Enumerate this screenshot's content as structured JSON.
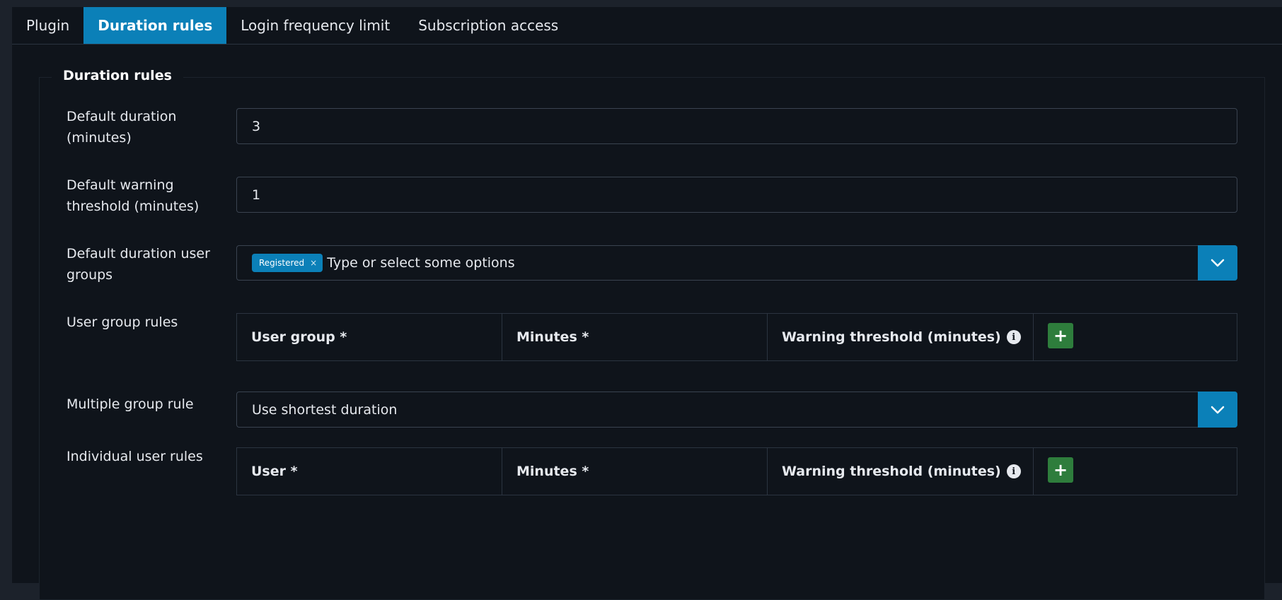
{
  "tabs": [
    {
      "label": "Plugin"
    },
    {
      "label": "Duration rules"
    },
    {
      "label": "Login frequency limit"
    },
    {
      "label": "Subscription access"
    }
  ],
  "section": {
    "legend": "Duration rules"
  },
  "fields": {
    "default_duration": {
      "label": "Default duration (minutes)",
      "value": "3"
    },
    "default_warning": {
      "label": "Default warning threshold (minutes)",
      "value": "1"
    },
    "default_groups": {
      "label": "Default duration user groups",
      "chip": "Registered",
      "chip_remove": "×",
      "placeholder": "Type or select some options"
    },
    "user_group_rules": {
      "label": "User group rules",
      "columns": [
        "User group *",
        "Minutes *",
        "Warning threshold (minutes)"
      ]
    },
    "multiple_group_rule": {
      "label": "Multiple group rule",
      "value": "Use shortest duration"
    },
    "individual_user_rules": {
      "label": "Individual user rules",
      "columns": [
        "User *",
        "Minutes *",
        "Warning threshold (minutes)"
      ]
    }
  },
  "icons": {
    "info": "i",
    "add": "+"
  },
  "colors": {
    "accent": "#0b80b8",
    "add_button": "#2e7d3c",
    "background": "#0f141b"
  }
}
